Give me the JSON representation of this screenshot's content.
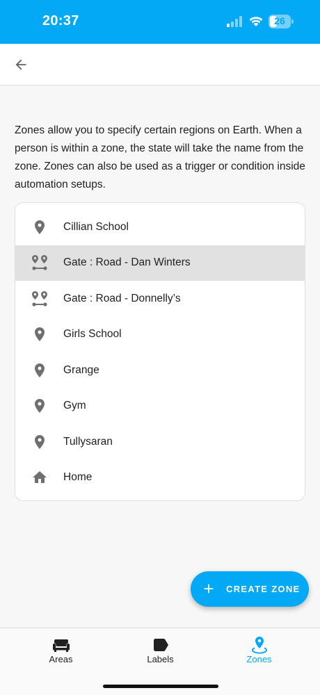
{
  "status_bar": {
    "time": "20:37",
    "battery_level": "26",
    "icons": [
      "signal-icon",
      "wifi-icon",
      "battery-icon"
    ]
  },
  "header": {
    "back_icon": "arrow-left-icon"
  },
  "description": "Zones allow you to specify certain regions on Earth. When a person is within a zone, the state will take the name from the zone. Zones can also be used as a trigger or condition inside automation setups.",
  "zones": [
    {
      "label": "Cillian School",
      "icon": "map-marker-icon",
      "selected": false
    },
    {
      "label": "Gate : Road - Dan Winters",
      "icon": "map-marker-path-icon",
      "selected": true
    },
    {
      "label": "Gate : Road - Donnelly’s",
      "icon": "map-marker-path-icon",
      "selected": false
    },
    {
      "label": "Girls School",
      "icon": "map-marker-icon",
      "selected": false
    },
    {
      "label": "Grange",
      "icon": "map-marker-icon",
      "selected": false
    },
    {
      "label": "Gym",
      "icon": "map-marker-icon",
      "selected": false
    },
    {
      "label": "Tullysaran",
      "icon": "map-marker-icon",
      "selected": false
    },
    {
      "label": "Home",
      "icon": "home-icon",
      "selected": false
    }
  ],
  "fab": {
    "label": "CREATE ZONE",
    "icon": "plus-icon"
  },
  "bottom_nav": {
    "tabs": [
      {
        "label": "Areas",
        "icon": "sofa-icon",
        "active": false
      },
      {
        "label": "Labels",
        "icon": "label-icon",
        "active": false
      },
      {
        "label": "Zones",
        "icon": "map-marker-radius-icon",
        "active": true
      }
    ]
  },
  "colors": {
    "accent": "#03a9f4",
    "icon_grey": "#6f6f6f",
    "selected_row": "#e1e1e1"
  }
}
